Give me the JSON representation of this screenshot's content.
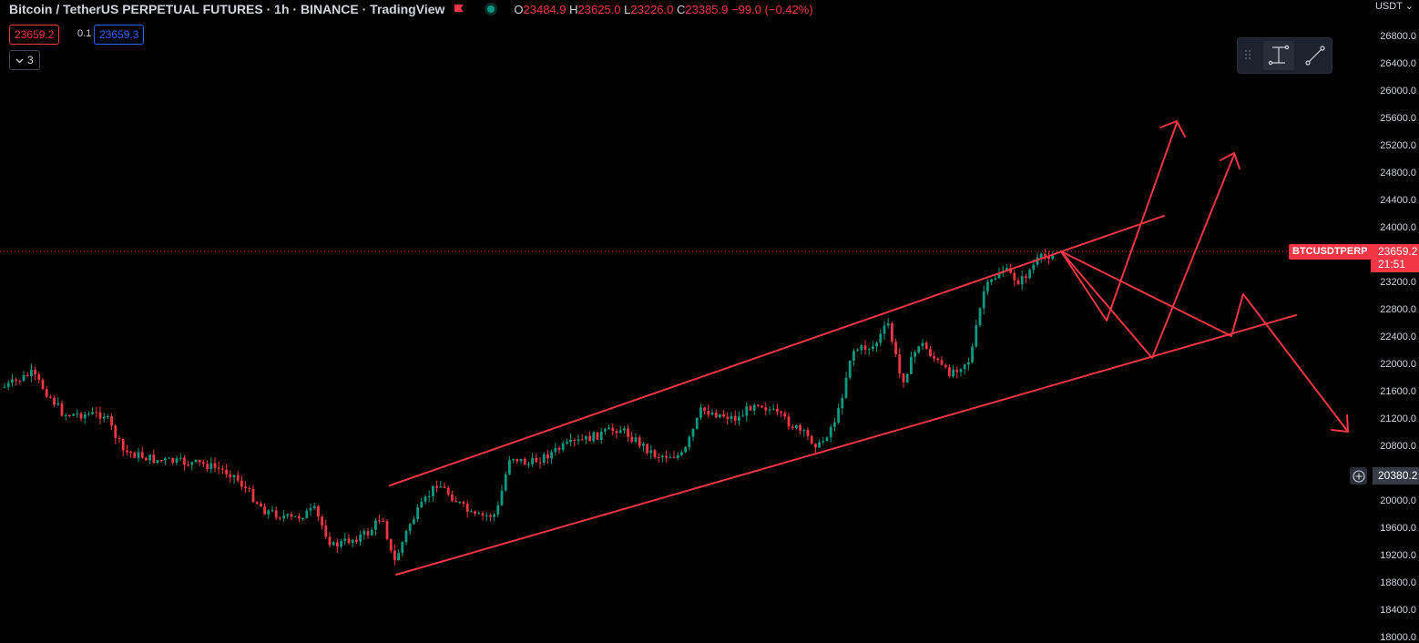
{
  "header": {
    "title": "Bitcoin / TetherUS PERPETUAL FUTURES · 1h · BINANCE · TradingView",
    "flag_icon": "flag-icon",
    "status_icon": "market-open-dot-icon",
    "ohlc": {
      "o_label": "O",
      "o_value": "23484.9",
      "h_label": "H",
      "h_value": "23625.0",
      "l_label": "L",
      "l_value": "23226.0",
      "c_label": "C",
      "c_value": "23385.9",
      "change": "−99.0 (−0.42%)"
    }
  },
  "trade": {
    "sell": "23659.2",
    "spread": "0.1",
    "buy": "23659.3"
  },
  "legend_toggle": {
    "icon": "chevron-down-icon",
    "count": "3"
  },
  "floating_toolbar": {
    "grip_icon": "drag-handle-icon",
    "tool1_icon": "anchored-measure-icon",
    "tool2_icon": "trend-line-icon"
  },
  "price_axis": {
    "currency": "USDT",
    "ticks": [
      "26800.0",
      "26400.0",
      "26000.0",
      "25600.0",
      "25200.0",
      "24800.0",
      "24400.0",
      "24000.0",
      "23200.0",
      "22800.0",
      "22400.0",
      "22000.0",
      "21600.0",
      "21200.0",
      "20800.0",
      "20000.0",
      "19600.0",
      "19200.0",
      "18800.0",
      "18400.0",
      "18000.0"
    ]
  },
  "last_price": {
    "symbol": "BTCUSDTPERP",
    "price": "23659.2",
    "countdown": "21:51"
  },
  "crosshair": {
    "price": "20380.2",
    "icon": "plus-circle-icon"
  },
  "colors": {
    "up": "#089981",
    "down": "#f23645",
    "drawing": "#f23645",
    "accent_blue": "#2962ff"
  }
}
